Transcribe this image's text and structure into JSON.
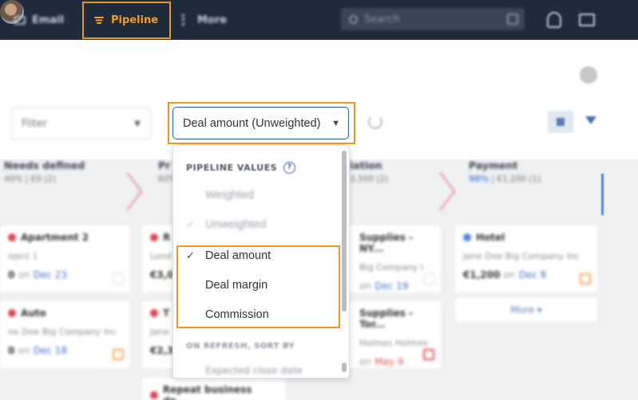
{
  "topbar": {
    "email_label": "Email",
    "pipeline_label": "Pipeline",
    "more_label": "More",
    "search_placeholder": "Search"
  },
  "toolbar": {
    "filter_label": "Filter",
    "pipeline_values_select": "Deal amount (Unweighted)"
  },
  "dropdown": {
    "header": "PIPELINE VALUES",
    "options": [
      {
        "label": "Weighted",
        "checked": false
      },
      {
        "label": "Unweighted",
        "checked": true
      },
      {
        "label": "Deal amount",
        "checked": true
      },
      {
        "label": "Deal margin",
        "checked": false
      },
      {
        "label": "Commission",
        "checked": false
      }
    ],
    "sort_header": "ON REFRESH, SORT BY",
    "sort_option": "Expected close date"
  },
  "board": {
    "stages": [
      {
        "title": "Needs defined",
        "pct": "40%",
        "value": "€0 (2)"
      },
      {
        "title": "Pr",
        "pct": "60%",
        "value": ""
      },
      {
        "title": "iation",
        "pct": "",
        "value": "3,500 (2)"
      },
      {
        "title": "Payment",
        "pct": "90%",
        "value": "€1,200 (1)"
      }
    ],
    "cards": [
      {
        "title": "Apartment 2",
        "sub": "oject 1",
        "amount": "0",
        "on": "on",
        "date": "Dec 23"
      },
      {
        "title": "Auto",
        "sub": "ne Doe Big Company Inc",
        "amount": "0",
        "on": "on",
        "date": "Dec 18"
      },
      {
        "title": "R",
        "sub": "Lond",
        "amount": "€3,0",
        "on": "",
        "date": ""
      },
      {
        "title": "T",
        "sub": "Jane",
        "amount": "€2,3",
        "on": "",
        "date": ""
      },
      {
        "title": "Repeat business de...",
        "sub": "",
        "amount": "",
        "on": "",
        "date": ""
      },
      {
        "title": "Supplies - NY...",
        "sub": "Big Company I",
        "amount": "",
        "on": "on",
        "date": "Dec 19"
      },
      {
        "title": "Supplies - Tor...",
        "sub": "Holmes Holmes",
        "amount": "",
        "on": "on",
        "date": "May 9"
      },
      {
        "title": "Hotel",
        "sub": "Jane Doe Big Company Inc",
        "amount": "€1,200",
        "on": "on",
        "date": "Dec 8"
      }
    ],
    "more_label": "More"
  },
  "colors": {
    "accent_orange": "#f0951f",
    "topbar_bg": "#1f2a3a",
    "select_border": "#2c5aa0"
  }
}
